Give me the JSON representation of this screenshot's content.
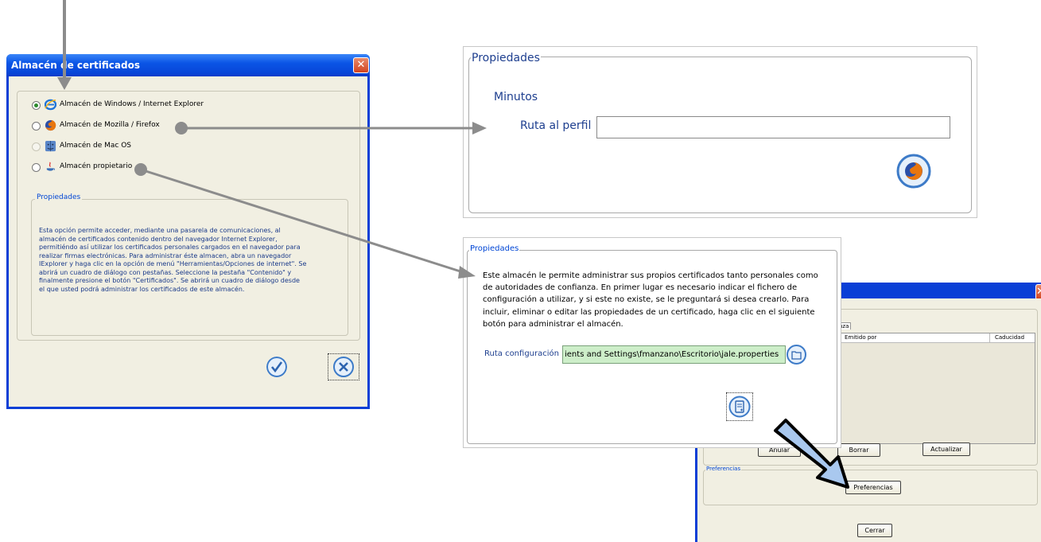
{
  "dialog_main": {
    "title": "Almacén de certificados",
    "options": [
      {
        "label": "Almacén de Windows / Internet Explorer",
        "icon": "internet-explorer-icon",
        "selected": true,
        "enabled": true
      },
      {
        "label": "Almacén de Mozilla / Firefox",
        "icon": "firefox-icon",
        "selected": false,
        "enabled": true
      },
      {
        "label": "Almacén de Mac OS",
        "icon": "mac-os-icon",
        "selected": false,
        "enabled": false
      },
      {
        "label": "Almacén propietario",
        "icon": "java-icon",
        "selected": false,
        "enabled": true
      }
    ],
    "properties_legend": "Propiedades",
    "description": [
      "Esta opción permite acceder, mediante una pasarela de comunicaciones, al",
      "almacén de certificados contenido dentro del navegador Internet Explorer,",
      "permitiéndo así utilizar los certificados personales cargados en el navegador para",
      "realizar firmas electrónicas. Para administrar éste almacen, abra un navegador",
      "IExplorer y haga clic en la opción de menú \"Herramientas/Opciones de internet\". Se",
      "abrirá un cuadro de diálogo con pestañas. Seleccione la pestaña \"Contenido\" y",
      "finalmente presione el botón \"Certificados\". Se abrirá un cuadro de diálogo desde",
      "el que usted podrá administrar los certificados de este almacén."
    ],
    "accept_icon": "check-icon",
    "cancel_icon": "cancel-icon"
  },
  "panel_firefox": {
    "legend": "Propiedades",
    "minutos_label": "Minutos",
    "profile_label": "Ruta al perfil",
    "profile_value": "",
    "button_icon": "firefox-icon"
  },
  "panel_propietario": {
    "legend": "Propiedades",
    "description": [
      "Este almacén le permite administrar sus propios certificados tanto personales como",
      "de autoridades de confianza. En primer lugar es necesario indicar el fichero de",
      "configuración a utilizar, y si este no existe, se le preguntará si desea crearlo. Para",
      "incluir, eliminar o editar las propiedades de un certificado, haga clic en el siguiente",
      "botón para administrar el almacén."
    ],
    "config_label": "Ruta configuración",
    "config_value": "ients and Settings\\fmanzano\\Escritorio\\jale.properties",
    "browse_icon": "folder-open-icon",
    "manage_icon": "certificate-store-icon"
  },
  "dialog_manager": {
    "tab_label": "nza",
    "columns": [
      "Emitido por",
      "Caducidad"
    ],
    "buttons": [
      "Anular",
      "Borrar",
      "Actualizar"
    ],
    "preferences_legend": "Preferencias",
    "preferences_button": "Preferencias",
    "close_button": "Cerrar"
  },
  "colors": {
    "xp_title_blue": "#0b55e6",
    "dialog_bg": "#f1efe2",
    "legend_blue": "#0046d5",
    "connector_gray": "#8c8c8c",
    "path_field_green": "#cdeec9",
    "pointer_arrow_fill": "#a9c8ef"
  }
}
